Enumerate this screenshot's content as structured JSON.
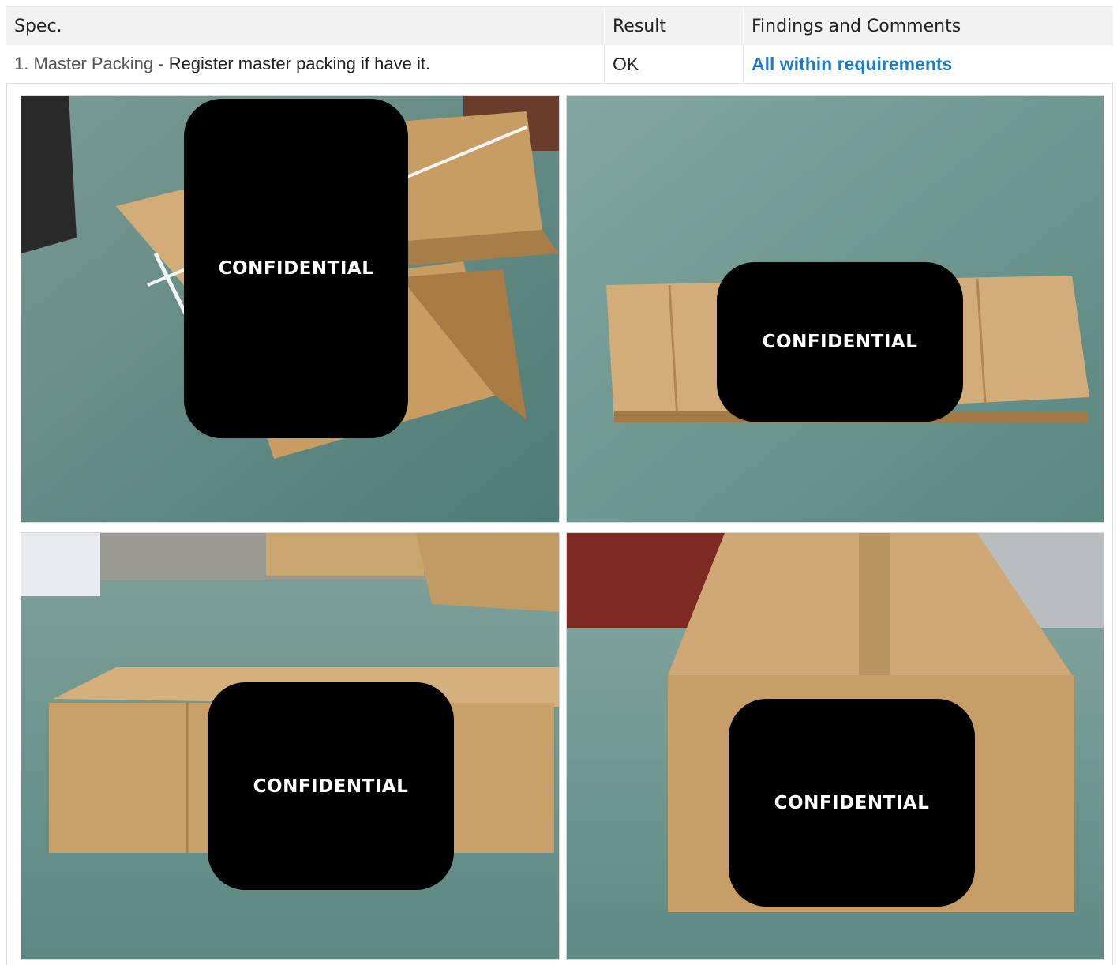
{
  "table": {
    "headers": {
      "spec": "Spec.",
      "result": "Result",
      "findings": "Findings and Comments"
    },
    "row": {
      "spec_number": "1.",
      "spec_name": "Master Packing",
      "spec_separator": "-",
      "spec_description": "Register master packing if have it.",
      "result": "OK",
      "findings": "All within requirements"
    }
  },
  "photos": [
    {
      "caption": "carton boxes strapped on warehouse floor",
      "redaction_label": "CONFIDENTIAL"
    },
    {
      "caption": "carton box top view",
      "redaction_label": "CONFIDENTIAL"
    },
    {
      "caption": "carton box side view with pallets behind",
      "redaction_label": "CONFIDENTIAL"
    },
    {
      "caption": "carton box end view",
      "redaction_label": "CONFIDENTIAL"
    }
  ],
  "colors": {
    "findings_text": "#1f7ac4",
    "header_bg": "#f2f2f2",
    "redaction": "#000000",
    "carton": "#c9a06a",
    "floor": "#5f8a84"
  }
}
